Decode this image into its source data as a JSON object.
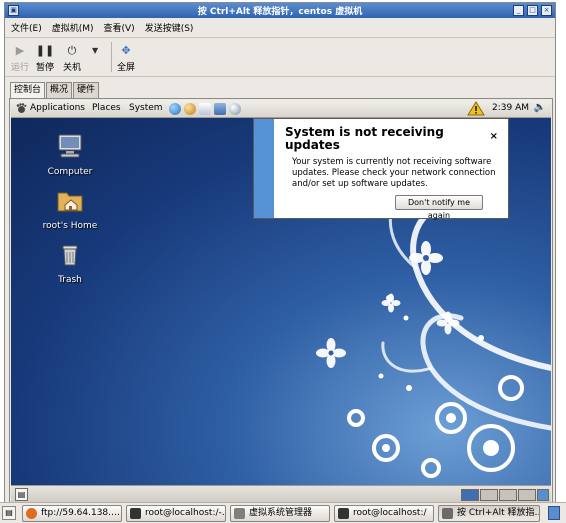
{
  "window": {
    "title": "按 Ctrl+Alt 释放指针，centos 虚拟机",
    "title_buttons": [
      "_",
      "□",
      "×"
    ]
  },
  "menubar": [
    "文件(E)",
    "虚拟机(M)",
    "查看(V)",
    "发送按键(S)"
  ],
  "toolbar": {
    "run": "运行",
    "pause": "暂停",
    "shutdown": "关机",
    "fullscreen": "全屏"
  },
  "tabs": [
    "控制台",
    "概况",
    "硬件"
  ],
  "guest": {
    "panel_menus": [
      "Applications",
      "Places",
      "System"
    ],
    "clock": "2:39 AM",
    "desktop_icons": [
      "Computer",
      "root's Home",
      "Trash"
    ],
    "notification": {
      "title": "System is not receiving updates",
      "close": "×",
      "body": "Your system is currently not receiving software updates.  Please check your network connection and/or set up software updates.",
      "button": "Don't notify me again"
    }
  },
  "host_taskbar": [
    {
      "label": "ftp://59.64.138.…",
      "icon_color": "#e06a1e"
    },
    {
      "label": "root@localhost:/-…",
      "icon_color": "#333333"
    },
    {
      "label": "虚拟系统管理器",
      "icon_color": "#7f7f7f"
    },
    {
      "label": "root@localhost:/",
      "icon_color": "#333333"
    },
    {
      "label": "按 Ctrl+Alt 释放指…",
      "icon_color": "#6b6b6b"
    }
  ],
  "colors": {
    "titlebar": "#2f63b0",
    "desktop_blue": "#2f5fa4",
    "notify_stripe": "#5592d6"
  }
}
